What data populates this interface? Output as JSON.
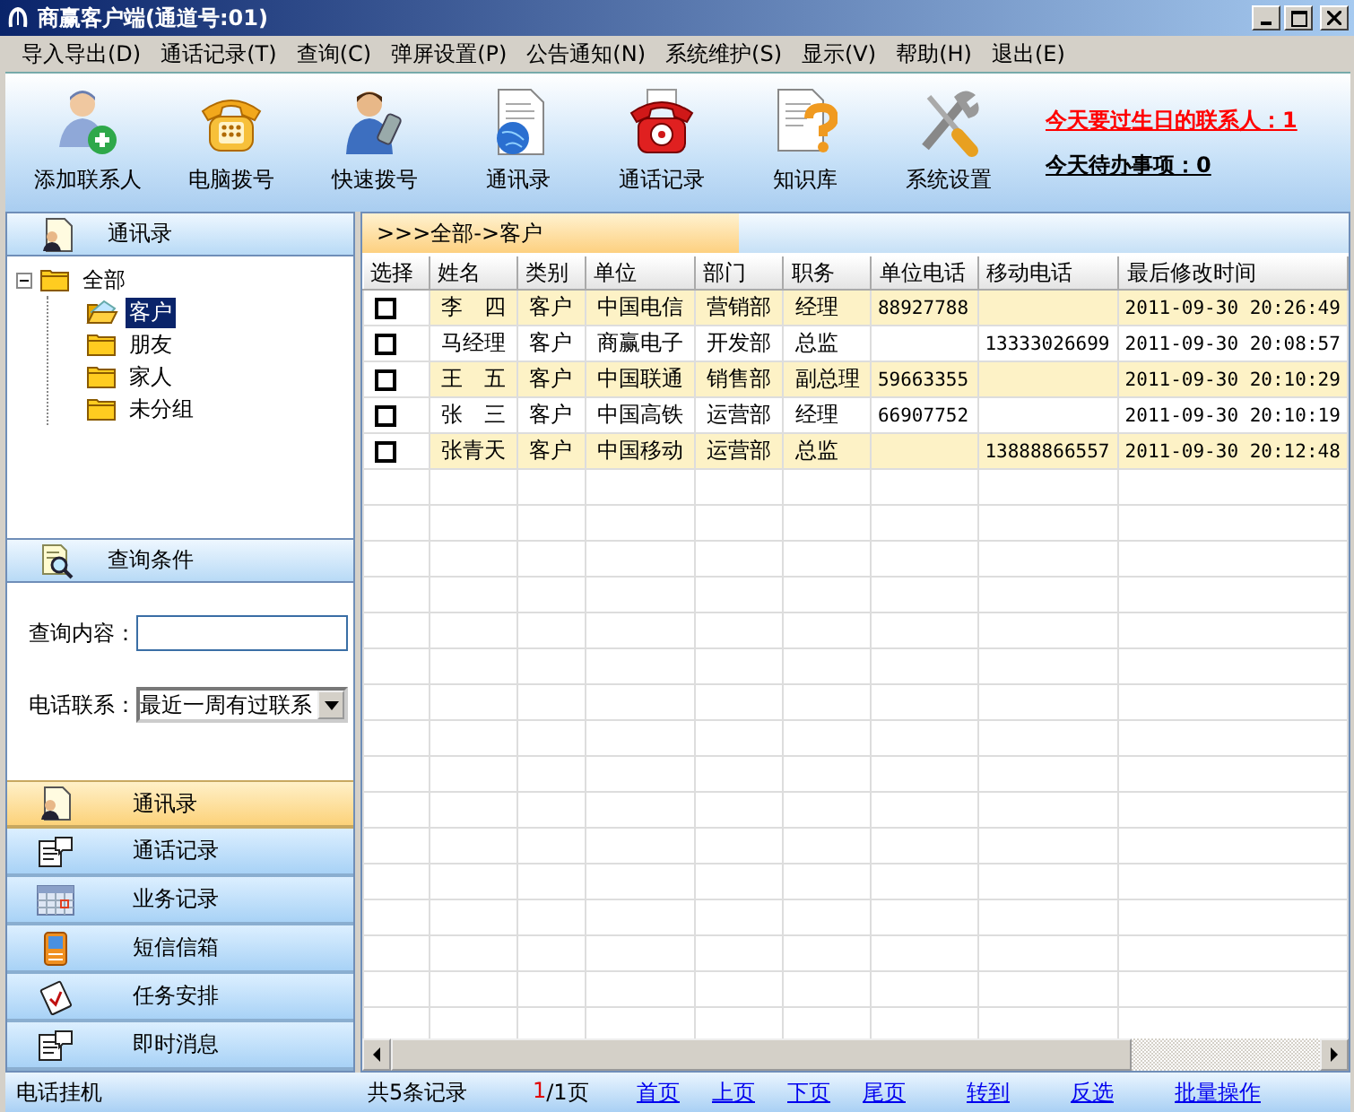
{
  "window": {
    "title": "商赢客户端(通道号:01)"
  },
  "menu": [
    "导入导出(D)",
    "通话记录(T)",
    "查询(C)",
    "弹屏设置(P)",
    "公告通知(N)",
    "系统维护(S)",
    "显示(V)",
    "帮助(H)",
    "退出(E)"
  ],
  "toolbar": {
    "buttons": [
      "添加联系人",
      "电脑拨号",
      "快速拨号",
      "通讯录",
      "通话记录",
      "知识库",
      "系统设置"
    ],
    "notices": [
      {
        "text": "今天要过生日的联系人：1",
        "kind": "alert"
      },
      {
        "text": "今天待办事项：0",
        "kind": "normal"
      }
    ]
  },
  "contacts_panel": {
    "title": "通讯录",
    "tree": {
      "label": "全部",
      "expanded": true,
      "selected": false,
      "children": [
        {
          "label": "客户",
          "selected": true
        },
        {
          "label": "朋友",
          "selected": false
        },
        {
          "label": "家人",
          "selected": false
        },
        {
          "label": "未分组",
          "selected": false
        }
      ]
    }
  },
  "query_panel": {
    "title": "查询条件",
    "fields": [
      {
        "label": "查询内容：",
        "kind": "text"
      },
      {
        "label": "电话联系：",
        "kind": "select",
        "value": "最近一周有过联系"
      }
    ]
  },
  "nav": [
    {
      "label": "通讯录",
      "selected": true
    },
    {
      "label": "通话记录",
      "selected": false
    },
    {
      "label": "业务记录",
      "selected": false
    },
    {
      "label": "短信信箱",
      "selected": false
    },
    {
      "label": "任务安排",
      "selected": false
    },
    {
      "label": "即时消息",
      "selected": false
    }
  ],
  "breadcrumb": ">>>全部->客户",
  "table": {
    "columns": [
      "选择",
      "姓名",
      "类别",
      "单位",
      "部门",
      "职务",
      "单位电话",
      "移动电话",
      "最后修改时间"
    ],
    "rows": [
      {
        "checked": false,
        "cells": [
          "",
          "李　四",
          "客户",
          "中国电信",
          "营销部",
          "经理",
          "88927788",
          "",
          "2011-09-30 20:26:49"
        ]
      },
      {
        "checked": false,
        "cells": [
          "",
          "马经理",
          "客户",
          "商赢电子",
          "开发部",
          "总监",
          "",
          "13333026699",
          "2011-09-30 20:08:57"
        ]
      },
      {
        "checked": false,
        "cells": [
          "",
          "王　五",
          "客户",
          "中国联通",
          "销售部",
          "副总理",
          "59663355",
          "",
          "2011-09-30 20:10:29"
        ]
      },
      {
        "checked": false,
        "cells": [
          "",
          "张　三",
          "客户",
          "中国高铁",
          "运营部",
          "经理",
          "66907752",
          "",
          "2011-09-30 20:10:19"
        ]
      },
      {
        "checked": false,
        "cells": [
          "",
          "张青天",
          "客户",
          "中国移动",
          "运营部",
          "总监",
          "",
          "13888866557",
          "2011-09-30 20:12:48"
        ]
      }
    ]
  },
  "status_bar": {
    "left": "电话挂机",
    "count": "共5条记录",
    "page_current": "1",
    "page_total": "/1页",
    "links": [
      "首页",
      "上页",
      "下页",
      "尾页",
      "转到",
      "反选",
      "批量操作"
    ]
  }
}
